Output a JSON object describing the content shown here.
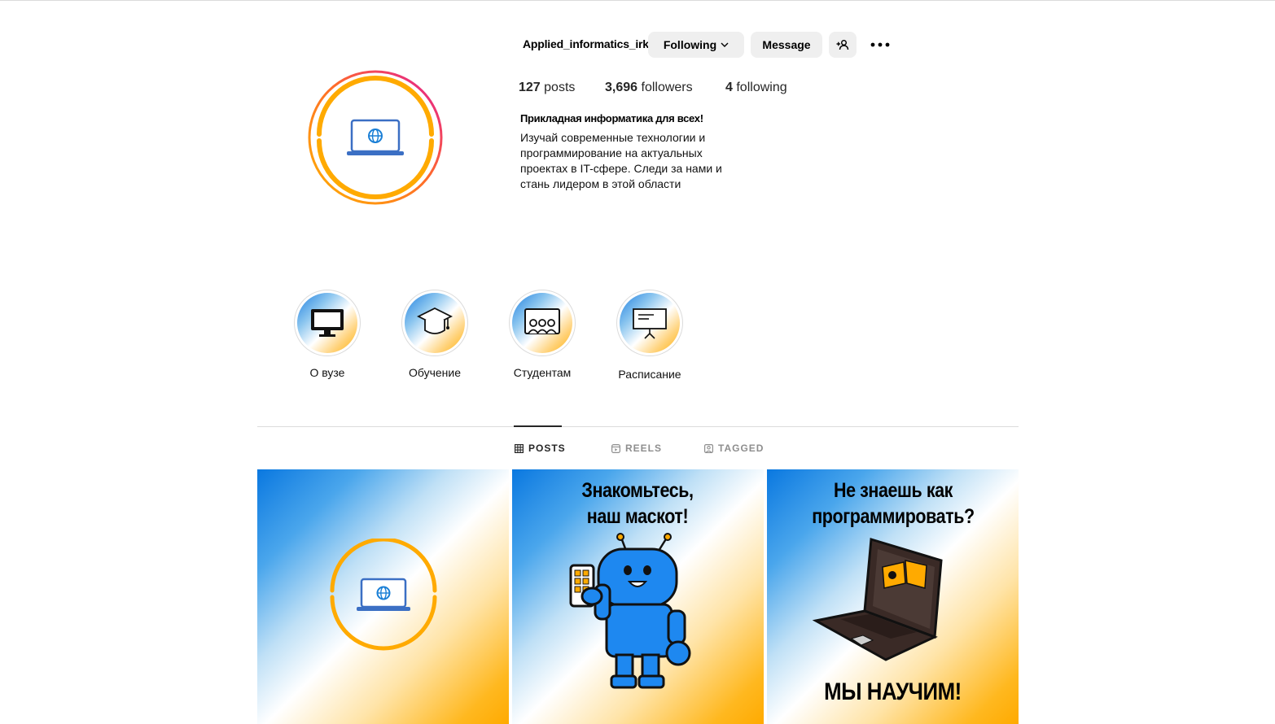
{
  "profile": {
    "username": "Applied_informatics_irk",
    "avatar_icon": "laptop-globe-icon",
    "buttons": {
      "following": "Following",
      "message": "Message"
    },
    "stats": {
      "posts_count": "127",
      "posts_label": "posts",
      "followers_count": "3,696",
      "followers_label": "followers",
      "following_count": "4",
      "following_label": "following"
    },
    "bio": {
      "title": "Прикладная информатика для всех!",
      "text": "Изучай современные технологии и программирование на актуальных проектах в IT-сфере. Следи за нами и стань лидером в этой области"
    }
  },
  "highlights": [
    {
      "label": "О вузе",
      "icon": "monitor-icon"
    },
    {
      "label": "Обучение",
      "icon": "graduation-cap-icon"
    },
    {
      "label": "Студентам",
      "icon": "students-board-icon"
    },
    {
      "label": "Расписание",
      "icon": "presentation-board-icon"
    }
  ],
  "tabs": [
    {
      "label": "POSTS",
      "icon": "grid-icon",
      "active": true
    },
    {
      "label": "REELS",
      "icon": "reels-icon",
      "active": false
    },
    {
      "label": "TAGGED",
      "icon": "tagged-icon",
      "active": false
    }
  ],
  "posts": [
    {
      "icon": "laptop-globe-icon"
    },
    {
      "caption": "Знакомьтесь, наш маскот!",
      "icon": "robot-mascot-icon"
    },
    {
      "caption_top": "Не знаешь как программировать?",
      "caption_bottom": "МЫ НАУЧИМ!",
      "icon": "laptop-icon"
    }
  ],
  "colors": {
    "accent_orange": "#ffaa00",
    "accent_blue": "#0a78e0",
    "story_ring_pink": "#e1189b",
    "button_bg": "#efefef"
  }
}
